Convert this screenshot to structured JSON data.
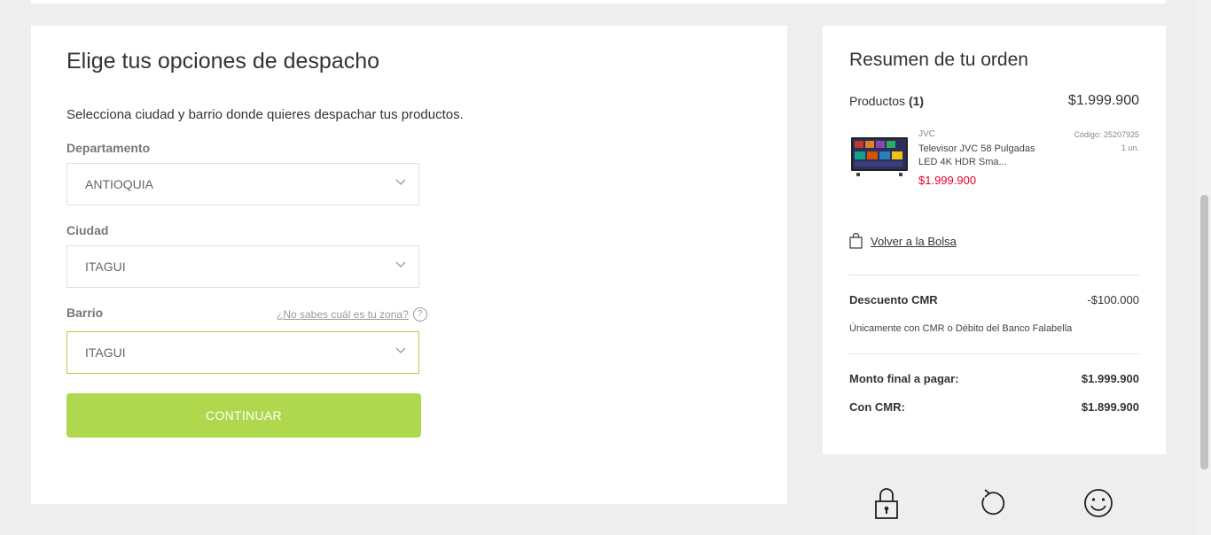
{
  "shipping": {
    "title": "Elige tus opciones de despacho",
    "subtitle": "Selecciona ciudad y barrio donde quieres despachar tus productos.",
    "department": {
      "label": "Departamento",
      "value": "ANTIOQUIA"
    },
    "city": {
      "label": "Ciudad",
      "value": "ITAGUI"
    },
    "neighborhood": {
      "label": "Barrio",
      "value": "ITAGUI",
      "help_link": "¿No sabes cuál es tu zona?",
      "help_icon": "?"
    },
    "continue_label": "CONTINUAR"
  },
  "summary": {
    "title": "Resumen de tu orden",
    "products_label": "Productos",
    "products_count": "(1)",
    "products_total": "$1.999.900",
    "item": {
      "brand": "JVC",
      "name": "Televisor JVC 58 Pulgadas LED 4K HDR Sma...",
      "price": "$1.999.900",
      "code": "Código: 25207925",
      "qty": "1 un."
    },
    "back_to_bag": "Volver a la Bolsa",
    "discount_label": "Descuento CMR",
    "discount_value": "-$100.000",
    "discount_note": "Únicamente con CMR o Débito del Banco Falabella",
    "final_label": "Monto final a pagar:",
    "final_value": "$1.999.900",
    "cmr_label": "Con CMR:",
    "cmr_value": "$1.899.900"
  },
  "colors": {
    "accent_green": "#b0d84e",
    "price_red": "#e4002b"
  },
  "icons": [
    "chevron-down-icon",
    "question-icon",
    "bag-icon",
    "lock-icon",
    "refresh-icon",
    "smiley-icon"
  ]
}
